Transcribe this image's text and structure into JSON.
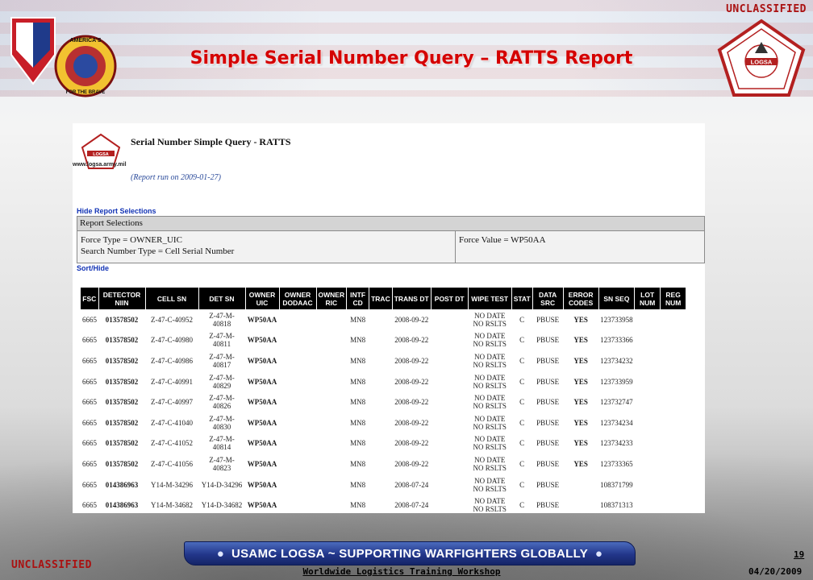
{
  "classification": {
    "top": "UNCLASSIFIED",
    "bottom": "UNCLASSIFIED"
  },
  "slide": {
    "title": "Simple Serial Number Query – RATTS Report"
  },
  "logos": {
    "left_seal_text": "AMERICA'S ARSENAL FOR THE BRAVE",
    "right_seal_text": "LOGSA"
  },
  "report": {
    "url": "www.logsa.army.mil",
    "logo_text": "LOGSA",
    "title": "Serial Number Simple Query - RATTS",
    "run_note": "(Report run on 2009-01-27)",
    "hide_selections_link": "Hide Report Selections",
    "selections_header": "Report Selections",
    "force_type": "Force Type = OWNER_UIC",
    "search_type": "Search Number Type = Cell Serial Number",
    "force_value": "Force Value = WP50AA",
    "sort_hide_link": "Sort/Hide"
  },
  "table": {
    "columns": [
      [
        "FSC"
      ],
      [
        "DETECTOR",
        "NIIN"
      ],
      [
        "CELL SN"
      ],
      [
        "DET SN"
      ],
      [
        "OWNER",
        "UIC"
      ],
      [
        "OWNER",
        "DODAAC"
      ],
      [
        "OWNER",
        "RIC"
      ],
      [
        "INTF",
        "CD"
      ],
      [
        "TRAC"
      ],
      [
        "TRANS DT"
      ],
      [
        "POST DT"
      ],
      [
        "WIPE TEST"
      ],
      [
        "STAT"
      ],
      [
        "DATA",
        "SRC"
      ],
      [
        "ERROR",
        "CODES"
      ],
      [
        "SN SEQ"
      ],
      [
        "LOT",
        "NUM"
      ],
      [
        "REG",
        "NUM"
      ]
    ],
    "rows": [
      [
        "6665",
        "013578502",
        "Z-47-C-40952",
        "Z-47-M-\n40818",
        "WP50AA",
        "",
        "",
        "MN8",
        "",
        "2008-09-22",
        "",
        "NO DATE\nNO RSLTS",
        "C",
        "PBUSE",
        "YES",
        "123733958",
        "",
        ""
      ],
      [
        "6665",
        "013578502",
        "Z-47-C-40980",
        "Z-47-M-\n40811",
        "WP50AA",
        "",
        "",
        "MN8",
        "",
        "2008-09-22",
        "",
        "NO DATE\nNO RSLTS",
        "C",
        "PBUSE",
        "YES",
        "123733366",
        "",
        ""
      ],
      [
        "6665",
        "013578502",
        "Z-47-C-40986",
        "Z-47-M-\n40817",
        "WP50AA",
        "",
        "",
        "MN8",
        "",
        "2008-09-22",
        "",
        "NO DATE\nNO RSLTS",
        "C",
        "PBUSE",
        "YES",
        "123734232",
        "",
        ""
      ],
      [
        "6665",
        "013578502",
        "Z-47-C-40991",
        "Z-47-M-\n40829",
        "WP50AA",
        "",
        "",
        "MN8",
        "",
        "2008-09-22",
        "",
        "NO DATE\nNO RSLTS",
        "C",
        "PBUSE",
        "YES",
        "123733959",
        "",
        ""
      ],
      [
        "6665",
        "013578502",
        "Z-47-C-40997",
        "Z-47-M-\n40826",
        "WP50AA",
        "",
        "",
        "MN8",
        "",
        "2008-09-22",
        "",
        "NO DATE\nNO RSLTS",
        "C",
        "PBUSE",
        "YES",
        "123732747",
        "",
        ""
      ],
      [
        "6665",
        "013578502",
        "Z-47-C-41040",
        "Z-47-M-\n40830",
        "WP50AA",
        "",
        "",
        "MN8",
        "",
        "2008-09-22",
        "",
        "NO DATE\nNO RSLTS",
        "C",
        "PBUSE",
        "YES",
        "123734234",
        "",
        ""
      ],
      [
        "6665",
        "013578502",
        "Z-47-C-41052",
        "Z-47-M-\n40814",
        "WP50AA",
        "",
        "",
        "MN8",
        "",
        "2008-09-22",
        "",
        "NO DATE\nNO RSLTS",
        "C",
        "PBUSE",
        "YES",
        "123734233",
        "",
        ""
      ],
      [
        "6665",
        "013578502",
        "Z-47-C-41056",
        "Z-47-M-\n40823",
        "WP50AA",
        "",
        "",
        "MN8",
        "",
        "2008-09-22",
        "",
        "NO DATE\nNO RSLTS",
        "C",
        "PBUSE",
        "YES",
        "123733365",
        "",
        ""
      ],
      [
        "6665",
        "014386963",
        "Y14-M-34296",
        "Y14-D-34296",
        "WP50AA",
        "",
        "",
        "MN8",
        "",
        "2008-07-24",
        "",
        "NO DATE\nNO RSLTS",
        "C",
        "PBUSE",
        "",
        "108371799",
        "",
        ""
      ],
      [
        "6665",
        "014386963",
        "Y14-M-34682",
        "Y14-D-34682",
        "WP50AA",
        "",
        "",
        "MN8",
        "",
        "2008-07-24",
        "",
        "NO DATE\nNO RSLTS",
        "C",
        "PBUSE",
        "",
        "108371313",
        "",
        ""
      ]
    ]
  },
  "footer": {
    "banner": "USAMC LOGSA ~ SUPPORTING WARFIGHTERS GLOBALLY",
    "workshop": "Worldwide Logistics Training Workshop",
    "page_number": "19",
    "date": "04/20/2009"
  },
  "colors": {
    "title_red": "#d40000",
    "classification_red": "#a11",
    "link_blue": "#1233b5",
    "banner_blue": "#22368a"
  }
}
